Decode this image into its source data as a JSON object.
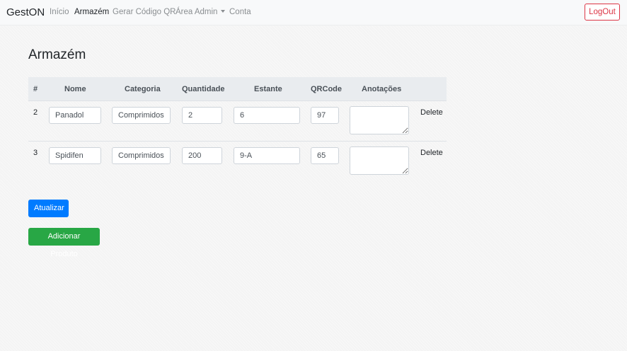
{
  "navbar": {
    "brand": "GestON",
    "links": [
      "Início",
      "Armazém",
      "Gerar Código QR",
      "Área Admin",
      "Conta"
    ],
    "logout": "LogOut"
  },
  "page": {
    "title": "Armazém"
  },
  "table": {
    "headers": [
      "#",
      "Nome",
      "Categoria",
      "Quantidade",
      "Estante",
      "QRCode",
      "Anotações"
    ],
    "rows": [
      {
        "id": "2",
        "nome": "Panadol",
        "categoria": "Comprimidos",
        "quantidade": "2",
        "estante": "6",
        "qrcode": "97",
        "anotacoes": "",
        "delete": "Delete"
      },
      {
        "id": "3",
        "nome": "Spidifen",
        "categoria": "Comprimidos",
        "quantidade": "200",
        "estante": "9-A",
        "qrcode": "65",
        "anotacoes": "",
        "delete": "Delete"
      }
    ]
  },
  "buttons": {
    "update": "Atualizar",
    "add_product": "Adicionar Produto"
  },
  "colors": {
    "primary": "#007bff",
    "success": "#28a745",
    "danger": "#dc3545",
    "navbar_bg": "#f8f9fa",
    "table_head_bg": "#e9ecef"
  }
}
